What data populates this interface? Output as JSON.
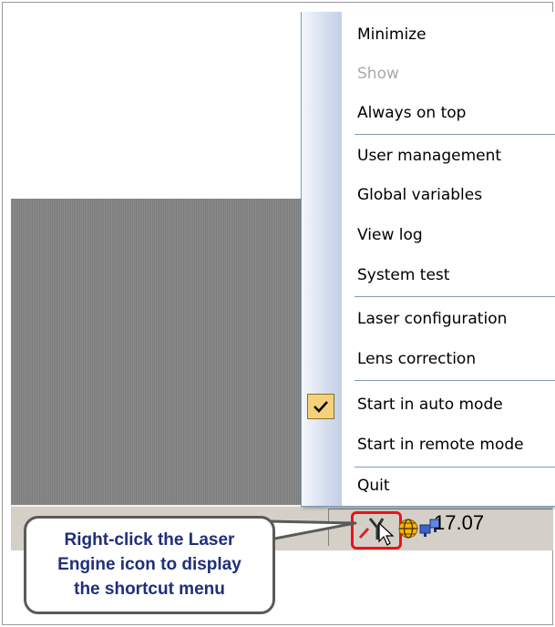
{
  "menu": {
    "items": [
      {
        "label": "Minimize",
        "enabled": true,
        "checked": false
      },
      {
        "label": "Show",
        "enabled": false,
        "checked": false
      },
      {
        "label": "Always on top",
        "enabled": true,
        "checked": false
      },
      {
        "label": "User management",
        "enabled": true,
        "checked": false
      },
      {
        "label": "Global variables",
        "enabled": true,
        "checked": false
      },
      {
        "label": "View log",
        "enabled": true,
        "checked": false
      },
      {
        "label": "System test",
        "enabled": true,
        "checked": false
      },
      {
        "label": "Laser configuration",
        "enabled": true,
        "checked": false
      },
      {
        "label": "Lens correction",
        "enabled": true,
        "checked": false
      },
      {
        "label": "Start in auto mode",
        "enabled": true,
        "checked": true
      },
      {
        "label": "Start in remote mode",
        "enabled": true,
        "checked": false
      },
      {
        "label": "Quit",
        "enabled": true,
        "checked": false
      }
    ]
  },
  "taskbar": {
    "clock": "17.07",
    "tray_icons": [
      "laser-engine-icon",
      "globe-icon",
      "network-icon"
    ]
  },
  "callout": {
    "line1": "Right-click the Laser",
    "line2": "Engine icon to display",
    "line3": "the shortcut menu"
  },
  "colors": {
    "callout_text": "#1f2f7a",
    "highlight": "#e8141b",
    "menu_separator": "#7f9db9",
    "check_background": "#f3d27a"
  }
}
